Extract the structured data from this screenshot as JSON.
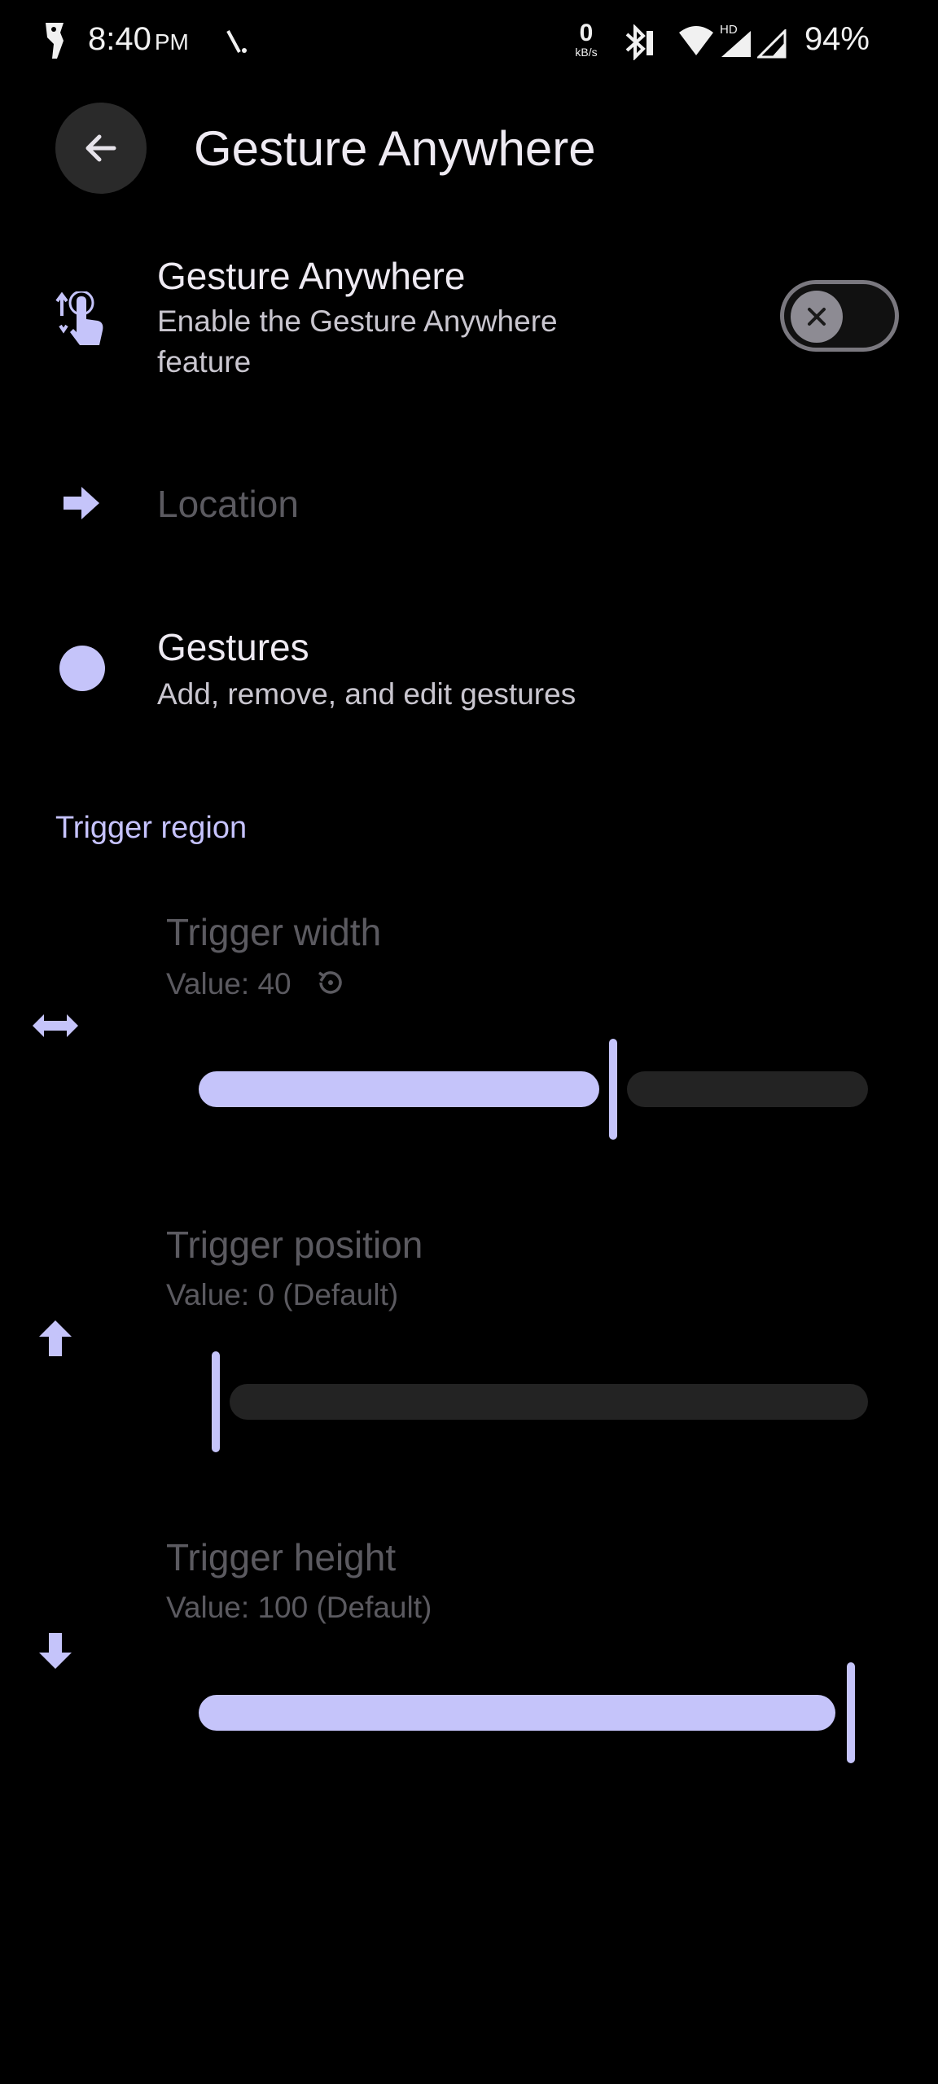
{
  "status_bar": {
    "time": "8:40",
    "ampm": "PM",
    "net_speed_value": "0",
    "net_speed_unit": "kB/s",
    "network_badge": "HD",
    "battery": "94%"
  },
  "header": {
    "title": "Gesture Anywhere"
  },
  "settings": {
    "enable": {
      "title": "Gesture Anywhere",
      "subtitle_line1": "Enable the Gesture Anywhere",
      "subtitle_line2": "feature",
      "toggle_on": false
    },
    "location": {
      "title": "Location"
    },
    "gestures": {
      "title": "Gestures",
      "subtitle": "Add, remove, and edit gestures"
    }
  },
  "trigger_region": {
    "header": "Trigger region",
    "width": {
      "title": "Trigger width",
      "value_text": "Value: 40",
      "fraction": 0.62
    },
    "position": {
      "title": "Trigger position",
      "value_text": "Value: 0 (Default)",
      "fraction": 0.0
    },
    "height": {
      "title": "Trigger height",
      "value_text": "Value: 100 (Default)",
      "fraction": 1.0
    }
  },
  "colors": {
    "accent": "#c5c4fa",
    "background": "#000000",
    "track_inactive": "#232323",
    "disabled_text": "#5b5a60"
  }
}
